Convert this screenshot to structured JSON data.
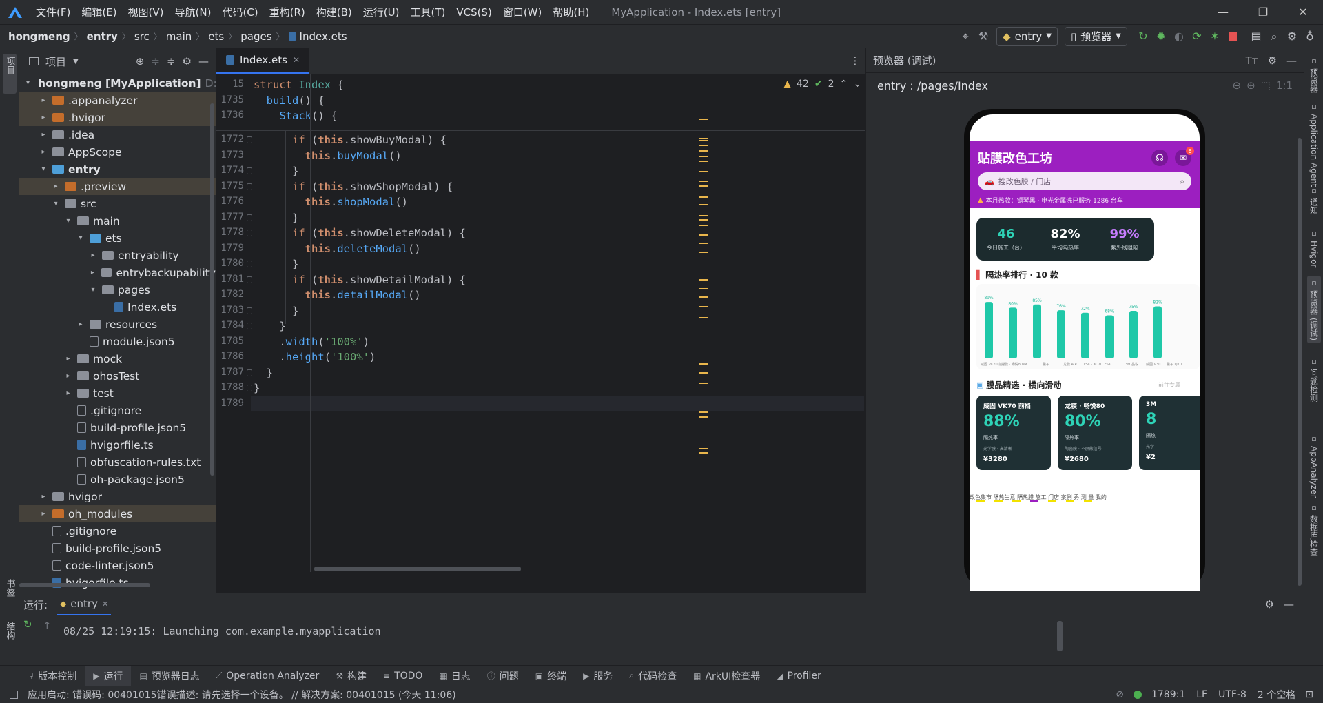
{
  "titlebar": {
    "menus": [
      "文件(F)",
      "编辑(E)",
      "视图(V)",
      "导航(N)",
      "代码(C)",
      "重构(R)",
      "构建(B)",
      "运行(U)",
      "工具(T)",
      "VCS(S)",
      "窗口(W)",
      "帮助(H)"
    ],
    "title": "MyApplication - Index.ets [entry]"
  },
  "breadcrumb": [
    "hongmeng",
    "entry",
    "src",
    "main",
    "ets",
    "pages",
    "Index.ets"
  ],
  "toolbar": {
    "run_config": "entry",
    "device": "预览器"
  },
  "left_strip": {
    "project_label": "项目",
    "bookmarks_label": "书签",
    "structure_label": "结构"
  },
  "project": {
    "title": "项目",
    "rows": [
      {
        "label": "hongmeng [MyApplication]",
        "suffix": "D:",
        "indent": 0,
        "arrow": "▾",
        "kind": "folder-g",
        "bold": true
      },
      {
        "label": ".appanalyzer",
        "indent": 1,
        "arrow": "▸",
        "kind": "folder-o",
        "hl": true
      },
      {
        "label": ".hvigor",
        "indent": 1,
        "arrow": "▸",
        "kind": "folder-o",
        "hl": true
      },
      {
        "label": ".idea",
        "indent": 1,
        "arrow": "▸",
        "kind": "folder-g"
      },
      {
        "label": "AppScope",
        "indent": 1,
        "arrow": "▸",
        "kind": "folder-g"
      },
      {
        "label": "entry",
        "indent": 1,
        "arrow": "▾",
        "kind": "folder-b",
        "bold": true
      },
      {
        "label": ".preview",
        "indent": 2,
        "arrow": "▸",
        "kind": "folder-o",
        "hl": true
      },
      {
        "label": "src",
        "indent": 2,
        "arrow": "▾",
        "kind": "folder-g"
      },
      {
        "label": "main",
        "indent": 3,
        "arrow": "▾",
        "kind": "folder-g"
      },
      {
        "label": "ets",
        "indent": 4,
        "arrow": "▾",
        "kind": "folder-b"
      },
      {
        "label": "entryability",
        "indent": 5,
        "arrow": "▸",
        "kind": "folder-g"
      },
      {
        "label": "entrybackupability",
        "indent": 5,
        "arrow": "▸",
        "kind": "folder-g"
      },
      {
        "label": "pages",
        "indent": 5,
        "arrow": "▾",
        "kind": "folder-g"
      },
      {
        "label": "Index.ets",
        "indent": 6,
        "arrow": "",
        "kind": "file-ts"
      },
      {
        "label": "resources",
        "indent": 4,
        "arrow": "▸",
        "kind": "folder-g"
      },
      {
        "label": "module.json5",
        "indent": 4,
        "arrow": "",
        "kind": "file"
      },
      {
        "label": "mock",
        "indent": 3,
        "arrow": "▸",
        "kind": "folder-g"
      },
      {
        "label": "ohosTest",
        "indent": 3,
        "arrow": "▸",
        "kind": "folder-g"
      },
      {
        "label": "test",
        "indent": 3,
        "arrow": "▸",
        "kind": "folder-g"
      },
      {
        "label": ".gitignore",
        "indent": 3,
        "arrow": "",
        "kind": "file"
      },
      {
        "label": "build-profile.json5",
        "indent": 3,
        "arrow": "",
        "kind": "file"
      },
      {
        "label": "hvigorfile.ts",
        "indent": 3,
        "arrow": "",
        "kind": "file-ts"
      },
      {
        "label": "obfuscation-rules.txt",
        "indent": 3,
        "arrow": "",
        "kind": "file"
      },
      {
        "label": "oh-package.json5",
        "indent": 3,
        "arrow": "",
        "kind": "file"
      },
      {
        "label": "hvigor",
        "indent": 1,
        "arrow": "▸",
        "kind": "folder-g"
      },
      {
        "label": "oh_modules",
        "indent": 1,
        "arrow": "▸",
        "kind": "folder-o",
        "hl": true
      },
      {
        "label": ".gitignore",
        "indent": 1,
        "arrow": "",
        "kind": "file"
      },
      {
        "label": "build-profile.json5",
        "indent": 1,
        "arrow": "",
        "kind": "file"
      },
      {
        "label": "code-linter.json5",
        "indent": 1,
        "arrow": "",
        "kind": "file"
      },
      {
        "label": "hvigorfile.ts",
        "indent": 1,
        "arrow": "",
        "kind": "file-ts"
      }
    ]
  },
  "editor": {
    "tab": "Index.ets",
    "warnings": "42",
    "weak_warnings": "2",
    "sticky": [
      {
        "n": "15",
        "code": [
          [
            "kw",
            "struct "
          ],
          [
            "ty",
            "Index"
          ],
          [
            "p",
            " {"
          ]
        ]
      },
      {
        "n": "1735",
        "code": [
          [
            "p",
            "  "
          ],
          [
            "fn",
            "build"
          ],
          [
            "p",
            "() {"
          ]
        ]
      },
      {
        "n": "1736",
        "code": [
          [
            "p",
            "    "
          ],
          [
            "fn",
            "Stack"
          ],
          [
            "p",
            "() {"
          ]
        ]
      }
    ],
    "lines": [
      {
        "n": "1772",
        "code": [
          [
            "p",
            "      "
          ],
          [
            "kw",
            "if "
          ],
          [
            "p",
            "("
          ],
          [
            "thisk",
            "this"
          ],
          [
            "p",
            ".showBuyModal) {"
          ]
        ]
      },
      {
        "n": "1773",
        "code": [
          [
            "p",
            "        "
          ],
          [
            "thisk",
            "this"
          ],
          [
            "p",
            "."
          ],
          [
            "fn",
            "buyModal"
          ],
          [
            "p",
            "()"
          ]
        ]
      },
      {
        "n": "1774",
        "code": [
          [
            "p",
            "      }"
          ]
        ]
      },
      {
        "n": "1775",
        "code": [
          [
            "p",
            "      "
          ],
          [
            "kw",
            "if "
          ],
          [
            "p",
            "("
          ],
          [
            "thisk",
            "this"
          ],
          [
            "p",
            ".showShopModal) {"
          ]
        ]
      },
      {
        "n": "1776",
        "code": [
          [
            "p",
            "        "
          ],
          [
            "thisk",
            "this"
          ],
          [
            "p",
            "."
          ],
          [
            "fn",
            "shopModal"
          ],
          [
            "p",
            "()"
          ]
        ]
      },
      {
        "n": "1777",
        "code": [
          [
            "p",
            "      }"
          ]
        ]
      },
      {
        "n": "1778",
        "code": [
          [
            "p",
            "      "
          ],
          [
            "kw",
            "if "
          ],
          [
            "p",
            "("
          ],
          [
            "thisk",
            "this"
          ],
          [
            "p",
            ".showDeleteModal) {"
          ]
        ]
      },
      {
        "n": "1779",
        "code": [
          [
            "p",
            "        "
          ],
          [
            "thisk",
            "this"
          ],
          [
            "p",
            "."
          ],
          [
            "fn",
            "deleteModal"
          ],
          [
            "p",
            "()"
          ]
        ]
      },
      {
        "n": "1780",
        "code": [
          [
            "p",
            "      }"
          ]
        ]
      },
      {
        "n": "1781",
        "code": [
          [
            "p",
            "      "
          ],
          [
            "kw",
            "if "
          ],
          [
            "p",
            "("
          ],
          [
            "thisk",
            "this"
          ],
          [
            "p",
            ".showDetailModal) {"
          ]
        ]
      },
      {
        "n": "1782",
        "code": [
          [
            "p",
            "        "
          ],
          [
            "thisk",
            "this"
          ],
          [
            "p",
            "."
          ],
          [
            "fn",
            "detailModal"
          ],
          [
            "p",
            "()"
          ]
        ]
      },
      {
        "n": "1783",
        "code": [
          [
            "p",
            "      }"
          ]
        ]
      },
      {
        "n": "1784",
        "code": [
          [
            "p",
            "    }"
          ]
        ]
      },
      {
        "n": "1785",
        "code": [
          [
            "p",
            "    ."
          ],
          [
            "fn",
            "width"
          ],
          [
            "p",
            "("
          ],
          [
            "str",
            "'100%'"
          ],
          [
            "p",
            ")"
          ]
        ]
      },
      {
        "n": "1786",
        "code": [
          [
            "p",
            "    ."
          ],
          [
            "fn",
            "height"
          ],
          [
            "p",
            "("
          ],
          [
            "str",
            "'100%'"
          ],
          [
            "p",
            ")"
          ]
        ]
      },
      {
        "n": "1787",
        "code": [
          [
            "p",
            "  }"
          ]
        ]
      },
      {
        "n": "1788",
        "code": [
          [
            "p",
            "}"
          ]
        ]
      },
      {
        "n": "1789",
        "code": [
          [
            "p",
            ""
          ]
        ]
      }
    ]
  },
  "preview": {
    "panel_title": "预览器 (调试)",
    "route": "entry : /pages/Index",
    "app": {
      "title": "贴膜改色工坊",
      "badge": "6",
      "search_placeholder": "搜改色膜 / 门店",
      "ticker": "本月热款：钢琴黑 · 电光金属洗已服务 1286 台车",
      "stats": [
        {
          "value": "46",
          "label": "今日施工（台）",
          "color": "#2ed3b7"
        },
        {
          "value": "82%",
          "label": "平均隔热率",
          "color": "#ffffff"
        },
        {
          "value": "99%",
          "label": "紫外线阻隔",
          "color": "#c77dff"
        }
      ],
      "chart_title": "隔热率排行 · 10 款",
      "cards_title": "膜品精选 · 横向滑动",
      "cards_hint": "前往专属",
      "cards": [
        {
          "name": "威固 VK70 前挡",
          "value": "88%",
          "metric": "隔热率",
          "tags": "光学膜 · 高清晰",
          "price": "¥3280"
        },
        {
          "name": "龙膜 · 畅悦80",
          "value": "80%",
          "metric": "隔热率",
          "tags": "陶瓷膜 · 不屏蔽信号",
          "price": "¥2680"
        },
        {
          "name": "3M",
          "value": "8",
          "metric": "隔热",
          "tags": "光学",
          "price": "¥2"
        }
      ],
      "bottom_text": "改色集市 隔热生意 隔热膜 施工 门店 案例 秀 测 量 我的"
    }
  },
  "chart_data": {
    "type": "bar",
    "title": "隔热率排行 · 10 款",
    "categories": [
      "威固 VK70 前挡",
      "龙膜 · 畅悦80",
      "3M",
      "量子",
      "龙膜 AIR",
      "FSK · XC70",
      "FSK",
      "3M 晶锐",
      "威固 V30",
      "量子 Q70"
    ],
    "values": [
      89,
      80,
      85,
      76,
      72,
      68,
      75,
      82
    ],
    "value_labels": [
      "89%",
      "80%",
      "85%",
      "76%",
      "72%",
      "68%",
      "75%",
      "82%"
    ],
    "ylim": [
      0,
      100
    ],
    "color": "#1fc8a8"
  },
  "run": {
    "label": "运行:",
    "config": "entry",
    "log": "08/25 12:19:15: Launching com.example.myapplication"
  },
  "bottom_tools": [
    "版本控制",
    "运行",
    "预览器日志",
    "Operation Analyzer",
    "构建",
    "TODO",
    "日志",
    "问题",
    "终端",
    "服务",
    "代码检查",
    "ArkUI检查器",
    "Profiler"
  ],
  "status": {
    "message": "应用启动: 错误码: 00401015错误描述: 请先选择一个设备。 // 解决方案: 00401015 (今天 11:06)",
    "position": "1789:1",
    "line_sep": "LF",
    "encoding": "UTF-8",
    "indent": "2 个空格"
  },
  "right_strip": [
    "预览器",
    "Application Agent",
    "通知",
    "Hvigor",
    "预览器 (调试)",
    "问题检测",
    "AppAnalyzer",
    "数据库检查"
  ]
}
